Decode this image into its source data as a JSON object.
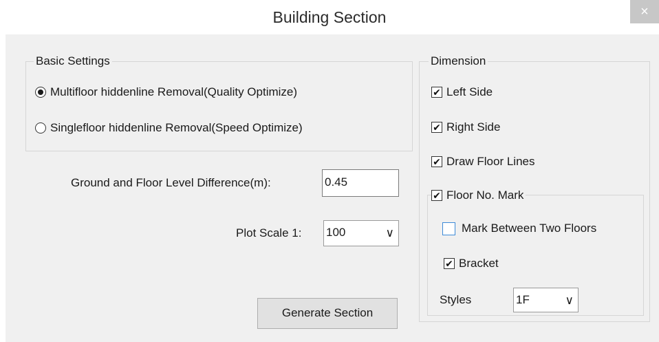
{
  "window": {
    "title": "Building Section",
    "close_symbol": "×"
  },
  "basic_settings": {
    "legend": "Basic Settings",
    "options": [
      {
        "label": "Multifloor hiddenline Removal(Quality Optimize)",
        "selected": true
      },
      {
        "label": "Singlefloor hiddenline Removal(Speed Optimize)",
        "selected": false
      }
    ]
  },
  "level_difference": {
    "label": "Ground and Floor Level Difference(m):",
    "value": "0.45"
  },
  "plot_scale": {
    "label": "Plot Scale  1:",
    "value": "100"
  },
  "generate_button": "Generate Section",
  "dimension": {
    "legend": "Dimension",
    "left_side": "Left Side",
    "right_side": "Right Side",
    "draw_floor_lines": "Draw Floor Lines",
    "floor_no_mark": "Floor No. Mark",
    "mark_between": "Mark Between Two Floors",
    "bracket": "Bracket",
    "styles_label": "Styles",
    "styles_value": "1F"
  },
  "check_mark": "✔",
  "arrow_glyph": "∨"
}
